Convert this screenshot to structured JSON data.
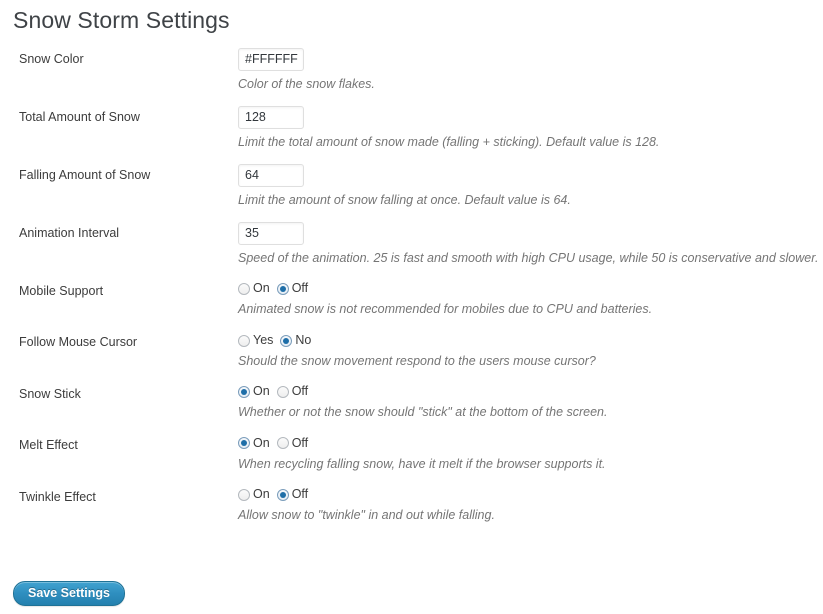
{
  "page": {
    "title": "Snow Storm Settings"
  },
  "fields": [
    {
      "label": "Snow Color",
      "type": "text",
      "value": "#FFFFFF",
      "description": "Color of the snow flakes."
    },
    {
      "label": "Total Amount of Snow",
      "type": "text",
      "value": "128",
      "description": "Limit the total amount of snow made (falling + sticking). Default value is 128."
    },
    {
      "label": "Falling Amount of Snow",
      "type": "text",
      "value": "64",
      "description": "Limit the amount of snow falling at once. Default value is 64."
    },
    {
      "label": "Animation Interval",
      "type": "text",
      "value": "35",
      "description": "Speed of the animation. 25 is fast and smooth with high CPU usage, while 50 is conservative and slower."
    },
    {
      "label": "Mobile Support",
      "type": "radio",
      "options": [
        "On",
        "Off"
      ],
      "selected": "Off",
      "description": "Animated snow is not recommended for mobiles due to CPU and batteries."
    },
    {
      "label": "Follow Mouse Cursor",
      "type": "radio",
      "options": [
        "Yes",
        "No"
      ],
      "selected": "No",
      "description": "Should the snow movement respond to the users mouse cursor?"
    },
    {
      "label": "Snow Stick",
      "type": "radio",
      "options": [
        "On",
        "Off"
      ],
      "selected": "On",
      "description": "Whether or not the snow should \"stick\" at the bottom of the screen."
    },
    {
      "label": "Melt Effect",
      "type": "radio",
      "options": [
        "On",
        "Off"
      ],
      "selected": "On",
      "description": "When recycling falling snow, have it melt if the browser supports it."
    },
    {
      "label": "Twinkle Effect",
      "type": "radio",
      "options": [
        "On",
        "Off"
      ],
      "selected": "Off",
      "description": "Allow snow to \"twinkle\" in and out while falling."
    }
  ],
  "submit": {
    "label": "Save Settings"
  },
  "colors": {
    "button_accent": "#2f8fc0",
    "radio_selected": "#1e6ea8",
    "title": "#3f4347",
    "description": "#757575"
  }
}
